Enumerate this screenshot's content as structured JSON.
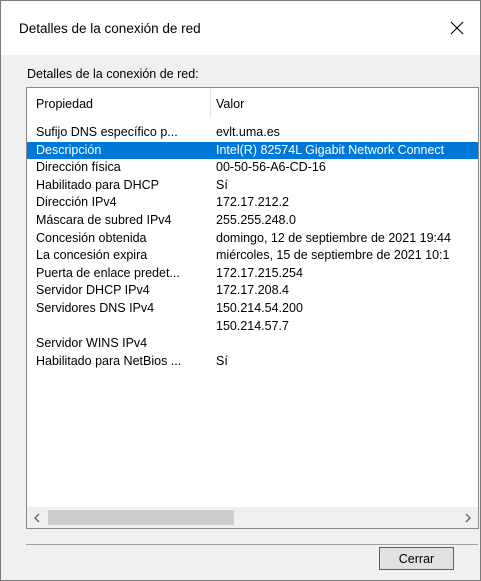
{
  "window": {
    "title": "Detalles de la conexión de red"
  },
  "group_label": "Detalles de la conexión de red:",
  "table": {
    "columns": [
      "Propiedad",
      "Valor"
    ],
    "rows": [
      {
        "prop": "Sufijo DNS específico p...",
        "val": "evlt.uma.es"
      },
      {
        "prop": "Descripción",
        "val": "Intel(R) 82574L Gigabit Network Connect"
      },
      {
        "prop": "Dirección física",
        "val": "00-50-56-A6-CD-16"
      },
      {
        "prop": "Habilitado para DHCP",
        "val": "Sí"
      },
      {
        "prop": "Dirección IPv4",
        "val": "172.17.212.2"
      },
      {
        "prop": "Máscara de subred IPv4",
        "val": "255.255.248.0"
      },
      {
        "prop": "Concesión obtenida",
        "val": "domingo, 12 de septiembre de 2021 19:44"
      },
      {
        "prop": "La concesión expira",
        "val": "miércoles, 15 de septiembre de 2021 10:1"
      },
      {
        "prop": "Puerta de enlace predet...",
        "val": "172.17.215.254"
      },
      {
        "prop": "Servidor DHCP IPv4",
        "val": "172.17.208.4"
      },
      {
        "prop": "Servidores DNS IPv4",
        "val": "150.214.54.200"
      },
      {
        "prop": "",
        "val": "150.214.57.7"
      },
      {
        "prop": "Servidor WINS IPv4",
        "val": ""
      },
      {
        "prop": "Habilitado para NetBios ...",
        "val": "Sí"
      }
    ],
    "selected_row": 1
  },
  "buttons": {
    "close_label": "Cerrar"
  },
  "icons": {
    "close": "close-icon",
    "scroll_left": "chevron-left-icon",
    "scroll_right": "chevron-right-icon"
  },
  "colors": {
    "selection": "#0078d7",
    "button_border": "#0078d7"
  }
}
